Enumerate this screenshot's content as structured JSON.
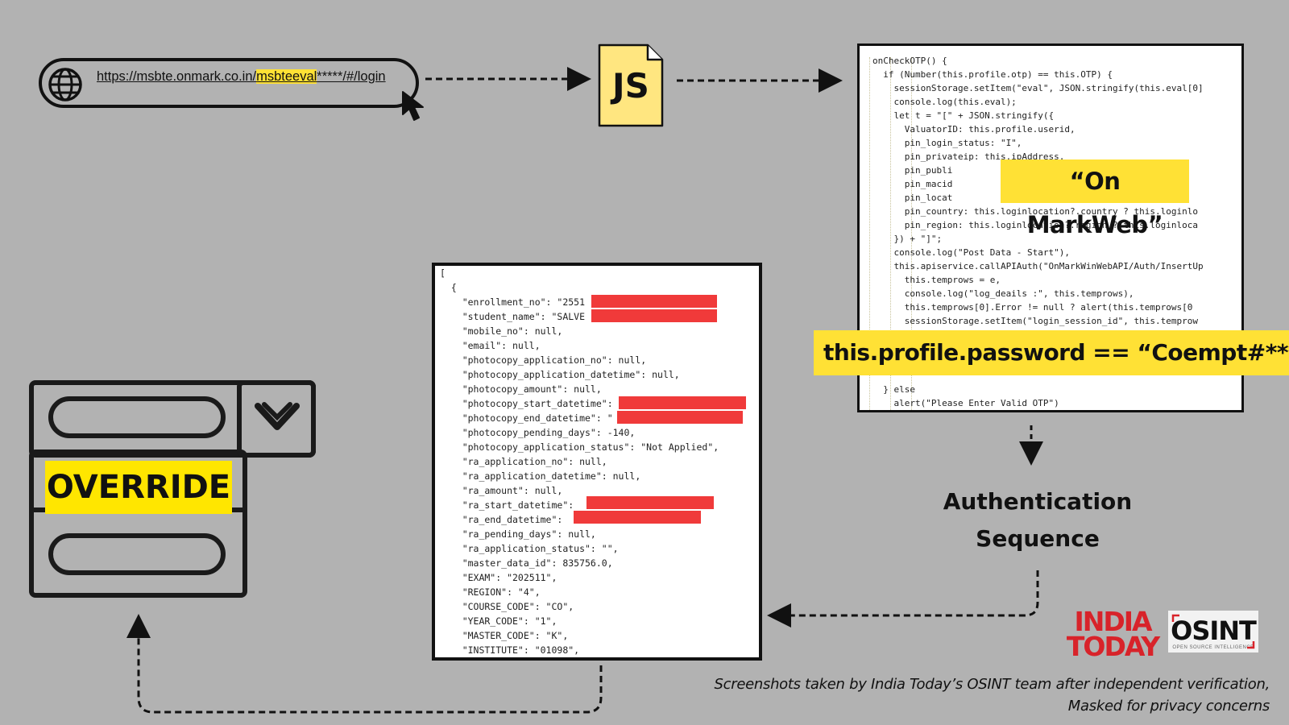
{
  "url_bar": {
    "url_prefix": "https://msbte.onmark.co.in/",
    "url_highlight": "msbteeval",
    "url_suffix": "*****/#/login"
  },
  "js_file": {
    "label": "JS"
  },
  "code_snippet": {
    "lines": [
      "onCheckOTP() {",
      "  if (Number(this.profile.otp) == this.OTP) {",
      "    sessionStorage.setItem(\"eval\", JSON.stringify(this.eval[0]",
      "    console.log(this.eval);",
      "    let t = \"[\" + JSON.stringify({",
      "      ValuatorID: this.profile.userid,",
      "      pin_login_status: \"I\",",
      "      pin_privateip: this.ipAddress,",
      "      pin_publi",
      "      pin_macid",
      "      pin_locat                              .loginloca",
      "      pin_country: this.loginlocation?.country ? this.loginlo",
      "      pin_region: this.loginlocation?.region ? this.loginloca",
      "    }) + \"]\";",
      "    console.log(\"Post Data - Start\"),",
      "    this.apiservice.callAPIAuth(\"OnMarkWinWebAPI/Auth/InsertUp",
      "      this.temprows = e,",
      "      console.log(\"log_deails :\", this.temprows),",
      "      this.temprows[0].Error != null ? alert(this.temprows[0",
      "      sessionStorage.setItem(\"login_session_id\", this.temprow",
      "",
      "",
      "",
      "",
      "  } else",
      "    alert(\"Please Enter Valid OTP\")"
    ]
  },
  "callouts": {
    "markweb": "“On MarkWeb”",
    "password": "this.profile.password == “Coempt#***”"
  },
  "auth_label": {
    "line1": "Authentication",
    "line2": "Sequence"
  },
  "json_panel": {
    "lines": [
      "[",
      "  {",
      "    \"enrollment_no\": \"2551",
      "    \"student_name\": \"SALVE",
      "    \"mobile_no\": null,",
      "    \"email\": null,",
      "    \"photocopy_application_no\": null,",
      "    \"photocopy_application_datetime\": null,",
      "    \"photocopy_amount\": null,",
      "    \"photocopy_start_datetime\":                     ,",
      "    \"photocopy_end_datetime\": \"",
      "    \"photocopy_pending_days\": -140,",
      "    \"photocopy_application_status\": \"Not Applied\",",
      "    \"ra_application_no\": null,",
      "    \"ra_application_datetime\": null,",
      "    \"ra_amount\": null,",
      "    \"ra_start_datetime\":",
      "    \"ra_end_datetime\":",
      "    \"ra_pending_days\": null,",
      "    \"ra_application_status\": \"\",",
      "    \"master_data_id\": 835756.0,",
      "    \"EXAM\": \"202511\",",
      "    \"REGION\": \"4\",",
      "    \"COURSE_CODE\": \"CO\",",
      "    \"YEAR_CODE\": \"1\",",
      "    \"MASTER_CODE\": \"K\",",
      "    \"INSTITUTE\": \"01098\","
    ]
  },
  "override_form": {
    "label": "OVERRIDE"
  },
  "logos": {
    "india_today_line1": "INDIA",
    "india_today_line2": "TODAY",
    "osint": "OSINT",
    "osint_tagline": "OPEN SOURCE INTELLIGENCE"
  },
  "credit": {
    "line1": "Screenshots taken by India Today’s OSINT team after independent verification,",
    "line2": "Masked for privacy concerns"
  },
  "colors": {
    "background": "#b2b2b2",
    "highlight": "#ffe135",
    "redaction": "#f03a3a",
    "brand_red": "#d8232a"
  }
}
